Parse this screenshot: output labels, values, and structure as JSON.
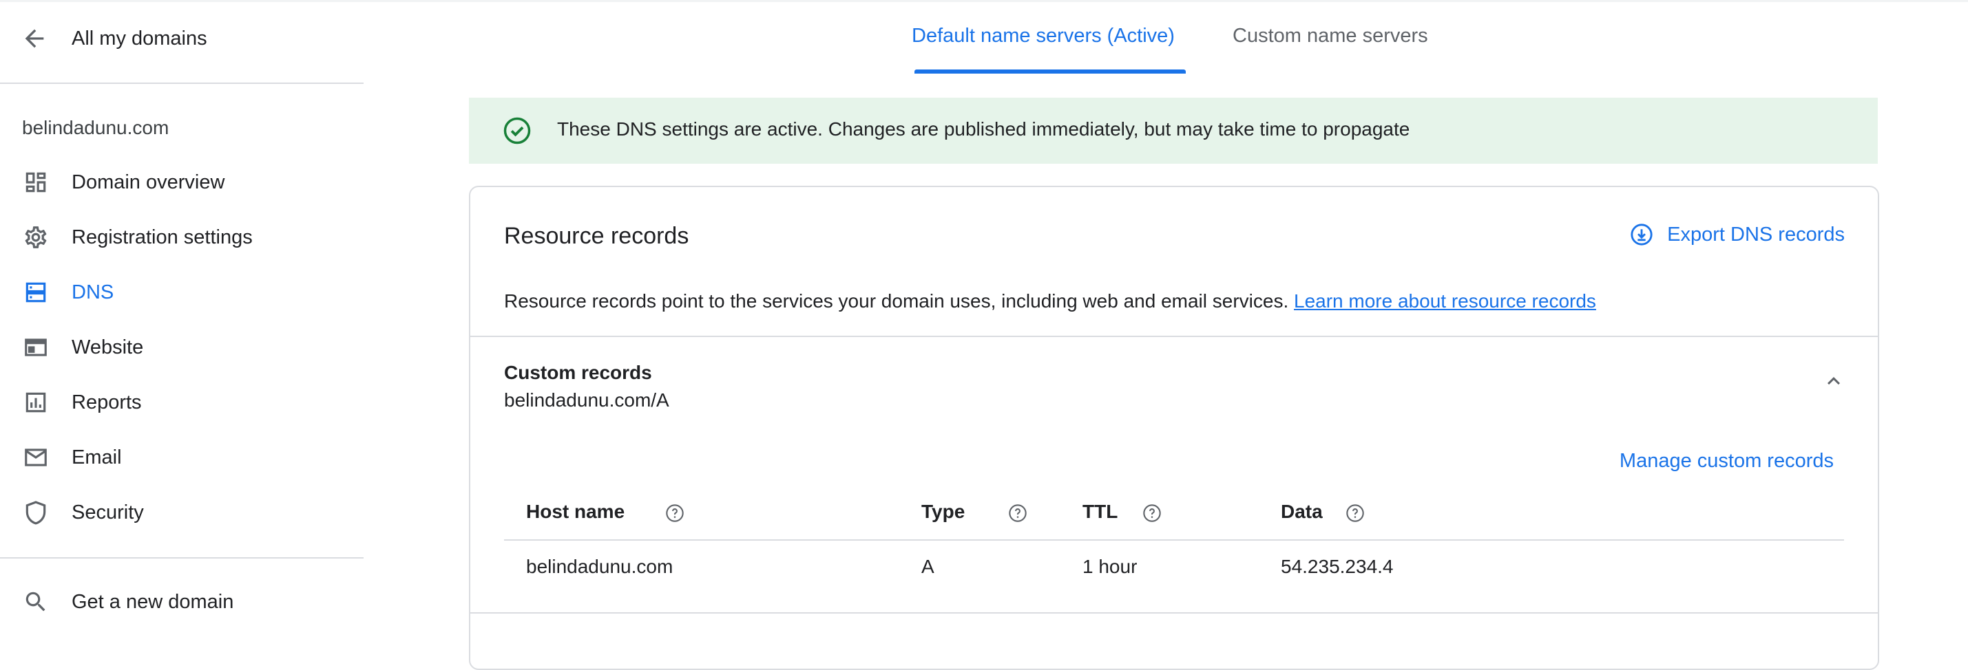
{
  "sidebar": {
    "back_label": "All my domains",
    "domain": "belindadunu.com",
    "items": [
      {
        "label": "Domain overview",
        "icon": "dashboard-icon"
      },
      {
        "label": "Registration settings",
        "icon": "gear-icon"
      },
      {
        "label": "DNS",
        "icon": "dns-icon",
        "active": true
      },
      {
        "label": "Website",
        "icon": "web-icon"
      },
      {
        "label": "Reports",
        "icon": "bar-chart-icon"
      },
      {
        "label": "Email",
        "icon": "mail-icon"
      },
      {
        "label": "Security",
        "icon": "shield-icon"
      }
    ],
    "get_domain_label": "Get a new domain"
  },
  "tabs": {
    "default": "Default name servers (Active)",
    "custom": "Custom name servers"
  },
  "banner": {
    "text": "These DNS settings are active. Changes are published immediately, but may take time to propagate"
  },
  "resource_records": {
    "title": "Resource records",
    "export_label": "Export DNS records",
    "description": "Resource records point to the services your domain uses, including web and email services.",
    "learn_more": "Learn more about resource records",
    "custom_records_title": "Custom records",
    "custom_records_sub": "belindadunu.com/A",
    "manage_label": "Manage custom records",
    "columns": {
      "host": "Host name",
      "type": "Type",
      "ttl": "TTL",
      "data": "Data"
    },
    "rows": [
      {
        "host": "belindadunu.com",
        "type": "A",
        "ttl": "1 hour",
        "data": "54.235.234.4"
      }
    ]
  },
  "colors": {
    "accent": "#1a73e8",
    "banner_bg": "#e6f4ea",
    "success": "#188038"
  }
}
